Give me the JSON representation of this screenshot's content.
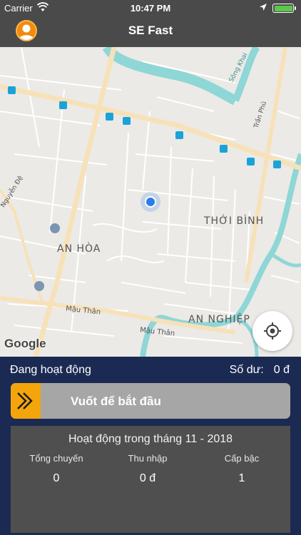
{
  "status_bar": {
    "carrier": "Carrier",
    "time": "10:47 PM",
    "icons": [
      "wifi-icon",
      "location-arrow-icon",
      "battery-icon"
    ]
  },
  "nav": {
    "title": "SE Fast",
    "left_icon": "user-avatar-icon"
  },
  "map": {
    "labels": {
      "an_hoa": "AN HÒA",
      "thoi_binh": "THỚI BÌNH",
      "an_nghiep": "AN NGHIỆP",
      "mau_than_1": "Mậu Thân",
      "mau_than_2": "Mậu Thân",
      "tran_phu": "Trần Phú",
      "nguyen_de": "Nguyễn Đệ",
      "song_khai": "Sông Khai"
    },
    "attribution": "Google",
    "locate_icon": "crosshair-locate-icon",
    "colors": {
      "water": "#8fd6d6",
      "major_road": "#f7e1b8",
      "bus_stop": "#1aa3d9",
      "user_dot": "#2b7de9"
    }
  },
  "panel": {
    "status_label": "Đang hoạt động",
    "balance_label": "Số dư:",
    "balance_value": "0 đ",
    "slider_label": "Vuốt để bắt đầu",
    "slider_icon": "double-chevron-right-icon",
    "stats": {
      "title": "Hoạt động trong tháng 11 - 2018",
      "columns": [
        {
          "label": "Tổng chuyến",
          "value": "0"
        },
        {
          "label": "Thu nhập",
          "value": "0 đ"
        },
        {
          "label": "Cấp bậc",
          "value": "1"
        }
      ]
    },
    "colors": {
      "panel_bg": "#1b2a52",
      "slider_knob": "#f5a50c",
      "slider_track": "#a6a6a6",
      "stats_bg": "#4f4f4f"
    }
  }
}
